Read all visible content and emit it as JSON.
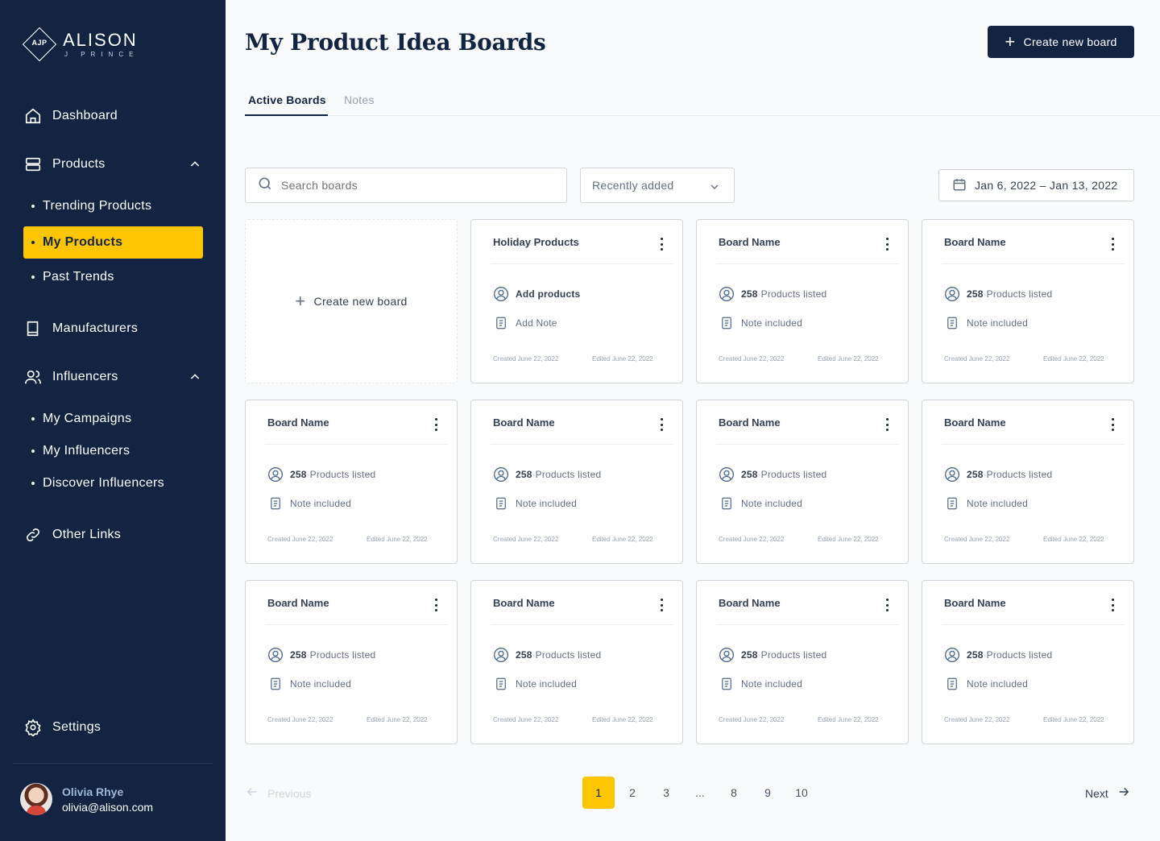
{
  "brand": {
    "mark": "AJP",
    "name": "ALISON",
    "sub": "J PRINCE"
  },
  "sidebar": {
    "dashboard": "Dashboard",
    "products": "Products",
    "products_sub": [
      "Trending Products",
      "My Products",
      "Past Trends"
    ],
    "manufacturers": "Manufacturers",
    "influencers": "Influencers",
    "influencers_sub": [
      "My Campaigns",
      "My Influencers",
      "Discover Influencers"
    ],
    "other_links": "Other Links",
    "settings": "Settings"
  },
  "user": {
    "name": "Olivia Rhye",
    "email": "olivia@alison.com"
  },
  "header": {
    "title": "My Product Idea Boards",
    "create_label": "Create new board"
  },
  "tabs": [
    "Active Boards",
    "Notes"
  ],
  "filters": {
    "search_placeholder": "Search boards",
    "sort": "Recently added",
    "date_range": "Jan 6, 2022 – Jan 13, 2022"
  },
  "create_card_label": "Create new board",
  "boards": [
    {
      "title": "Holiday Products",
      "products": "Add products",
      "note": "Add Note",
      "created": "Created June 22, 2022",
      "edited": "Edited June 22, 2022"
    },
    {
      "title": "Board Name",
      "count": "258",
      "products": "Products listed",
      "note": "Note included",
      "created": "Created June 22, 2022",
      "edited": "Edited June 22, 2022"
    },
    {
      "title": "Board Name",
      "count": "258",
      "products": "Products listed",
      "note": "Note included",
      "created": "Created June 22, 2022",
      "edited": "Edited June 22, 2022"
    },
    {
      "title": "Board Name",
      "count": "258",
      "products": "Products listed",
      "note": "Note included",
      "created": "Created June 22, 2022",
      "edited": "Edited June 22, 2022"
    },
    {
      "title": "Board Name",
      "count": "258",
      "products": "Products listed",
      "note": "Note included",
      "created": "Created June 22, 2022",
      "edited": "Edited June 22, 2022"
    },
    {
      "title": "Board Name",
      "count": "258",
      "products": "Products listed",
      "note": "Note included",
      "created": "Created June 22, 2022",
      "edited": "Edited June 22, 2022"
    },
    {
      "title": "Board Name",
      "count": "258",
      "products": "Products listed",
      "note": "Note included",
      "created": "Created June 22, 2022",
      "edited": "Edited June 22, 2022"
    },
    {
      "title": "Board Name",
      "count": "258",
      "products": "Products listed",
      "note": "Note included",
      "created": "Created June 22, 2022",
      "edited": "Edited June 22, 2022"
    },
    {
      "title": "Board Name",
      "count": "258",
      "products": "Products listed",
      "note": "Note included",
      "created": "Created June 22, 2022",
      "edited": "Edited June 22, 2022"
    },
    {
      "title": "Board Name",
      "count": "258",
      "products": "Products listed",
      "note": "Note included",
      "created": "Created June 22, 2022",
      "edited": "Edited June 22, 2022"
    },
    {
      "title": "Board Name",
      "count": "258",
      "products": "Products listed",
      "note": "Note included",
      "created": "Created June 22, 2022",
      "edited": "Edited June 22, 2022"
    }
  ],
  "pagination": {
    "previous": "Previous",
    "next": "Next",
    "pages": [
      "1",
      "2",
      "3",
      "...",
      "8",
      "9",
      "10"
    ],
    "current": "1"
  }
}
